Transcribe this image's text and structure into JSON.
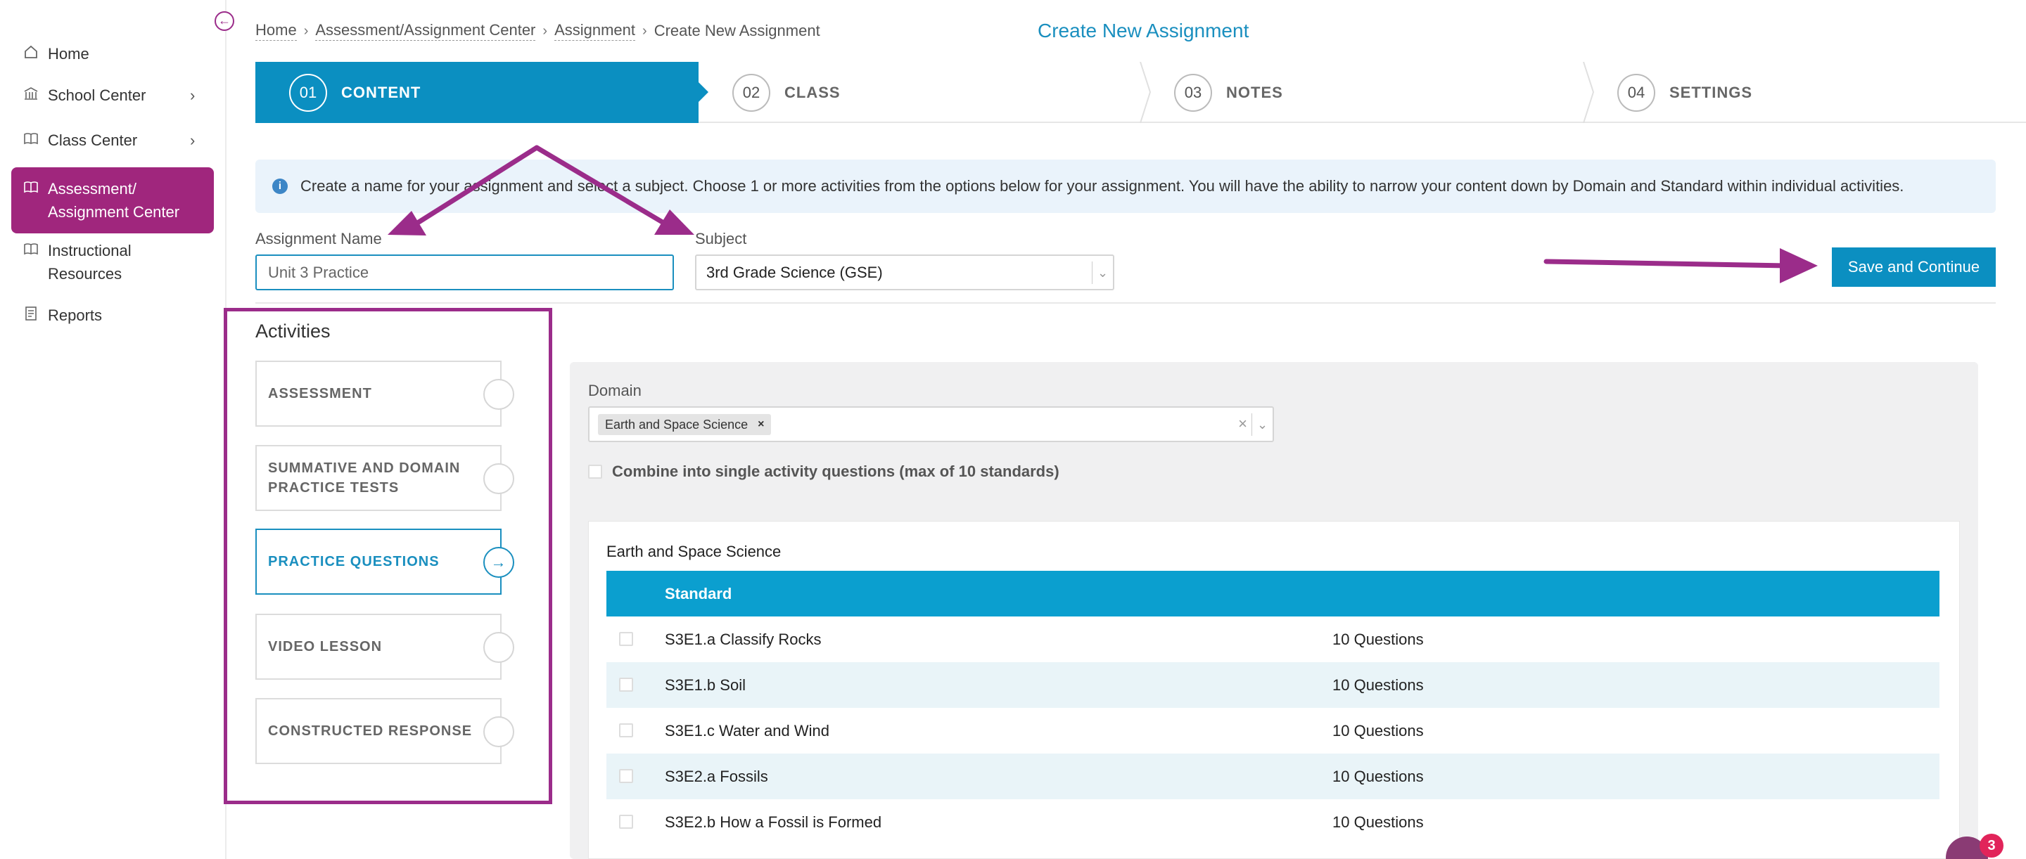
{
  "sidebar": {
    "items": [
      {
        "label": "Home",
        "icon": "home-icon"
      },
      {
        "label": "School Center",
        "icon": "building-icon",
        "has_children": true
      },
      {
        "label": "Class Center",
        "icon": "book-icon",
        "has_children": true
      },
      {
        "label": "Assessment/ Assignment Center",
        "line1": "Assessment/",
        "line2": "Assignment Center",
        "icon": "open-book-icon",
        "active": true
      },
      {
        "label": "Instructional Resources",
        "line1": "Instructional",
        "line2": "Resources",
        "icon": "open-book-icon"
      },
      {
        "label": "Reports",
        "icon": "report-icon"
      }
    ],
    "active_color": "#a0267d"
  },
  "breadcrumb": {
    "items": [
      "Home",
      "Assessment/Assignment Center",
      "Assignment"
    ],
    "current": "Create New Assignment"
  },
  "page_title": "Create New Assignment",
  "steps": [
    {
      "num": "01",
      "label": "CONTENT",
      "active": true
    },
    {
      "num": "02",
      "label": "CLASS"
    },
    {
      "num": "03",
      "label": "NOTES"
    },
    {
      "num": "04",
      "label": "SETTINGS"
    }
  ],
  "info_text": "Create a name for your assignment and select a subject. Choose 1 or more activities from the options below for your assignment. You will have the ability to narrow your content down by Domain and Standard within individual activities.",
  "form": {
    "name_label": "Assignment Name",
    "name_value": "Unit 3 Practice",
    "subject_label": "Subject",
    "subject_value": "3rd Grade Science (GSE)",
    "save_label": "Save and Continue"
  },
  "activities": {
    "title": "Activities",
    "items": [
      {
        "label": "ASSESSMENT"
      },
      {
        "label": "SUMMATIVE AND DOMAIN PRACTICE TESTS",
        "line1": "SUMMATIVE AND DOMAIN",
        "line2": "PRACTICE TESTS"
      },
      {
        "label": "PRACTICE QUESTIONS",
        "selected": true
      },
      {
        "label": "VIDEO LESSON"
      },
      {
        "label": "CONSTRUCTED RESPONSE"
      }
    ]
  },
  "domain": {
    "label": "Domain",
    "tag": "Earth and Space Science",
    "combine_label": "Combine into single activity questions (max of 10 standards)"
  },
  "table": {
    "title": "Earth and Space Science",
    "header": "Standard",
    "rows": [
      {
        "standard": "S3E1.a Classify Rocks",
        "questions": "10 Questions"
      },
      {
        "standard": "S3E1.b Soil",
        "questions": "10 Questions"
      },
      {
        "standard": "S3E1.c Water and Wind",
        "questions": "10 Questions"
      },
      {
        "standard": "S3E2.a Fossils",
        "questions": "10 Questions"
      },
      {
        "standard": "S3E2.b How a Fossil is Formed",
        "questions": "10 Questions"
      }
    ]
  },
  "chat_badge_count": "3",
  "colors": {
    "accent": "#0b8fc1",
    "annotation": "#9b2c8a"
  }
}
